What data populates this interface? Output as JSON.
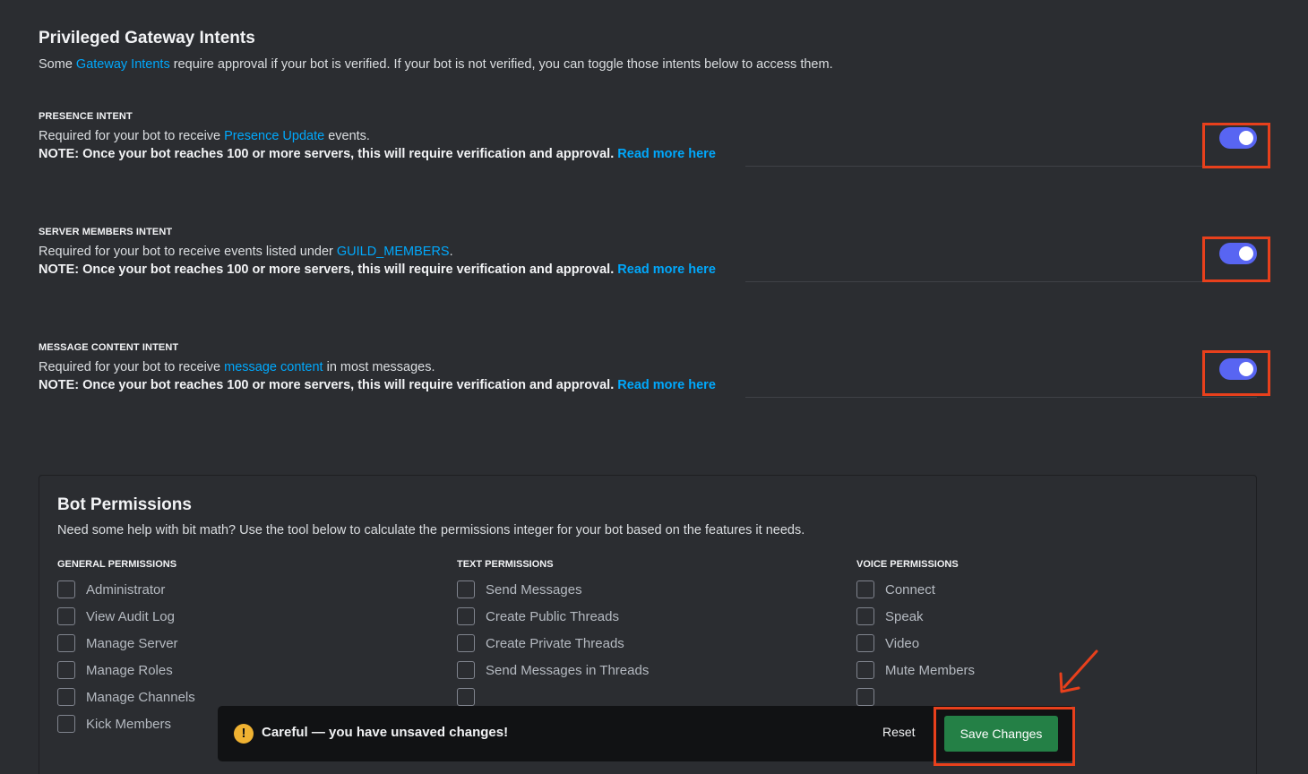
{
  "intents_section": {
    "title": "Privileged Gateway Intents",
    "desc_prefix": "Some ",
    "desc_link": "Gateway Intents",
    "desc_suffix": " require approval if your bot is verified. If your bot is not verified, you can toggle those intents below to access them."
  },
  "intents": [
    {
      "label": "PRESENCE INTENT",
      "desc_prefix": "Required for your bot to receive ",
      "desc_link": "Presence Update",
      "desc_suffix": " events.",
      "note": "NOTE: Once your bot reaches 100 or more servers, this will require verification and approval.",
      "note_link": "Read more here",
      "enabled": true
    },
    {
      "label": "SERVER MEMBERS INTENT",
      "desc_prefix": "Required for your bot to receive events listed under ",
      "desc_link": "GUILD_MEMBERS",
      "desc_suffix": ".",
      "note": "NOTE: Once your bot reaches 100 or more servers, this will require verification and approval.",
      "note_link": "Read more here",
      "enabled": true
    },
    {
      "label": "MESSAGE CONTENT INTENT",
      "desc_prefix": "Required for your bot to receive ",
      "desc_link": "message content",
      "desc_suffix": " in most messages.",
      "note": "NOTE: Once your bot reaches 100 or more servers, this will require verification and approval.",
      "note_link": "Read more here",
      "enabled": true
    }
  ],
  "permissions": {
    "title": "Bot Permissions",
    "desc": "Need some help with bit math? Use the tool below to calculate the permissions integer for your bot based on the features it needs.",
    "columns": [
      {
        "title": "GENERAL PERMISSIONS",
        "items": [
          "Administrator",
          "View Audit Log",
          "Manage Server",
          "Manage Roles",
          "Manage Channels",
          "Kick Members"
        ]
      },
      {
        "title": "TEXT PERMISSIONS",
        "items": [
          "Send Messages",
          "Create Public Threads",
          "Create Private Threads",
          "Send Messages in Threads"
        ]
      },
      {
        "title": "VOICE PERMISSIONS",
        "items": [
          "Connect",
          "Speak",
          "Video",
          "Mute Members"
        ]
      }
    ]
  },
  "save_bar": {
    "icon": "!",
    "message": "Careful — you have unsaved changes!",
    "reset_label": "Reset",
    "save_label": "Save Changes"
  },
  "colors": {
    "background": "#2b2d31",
    "toggle_on": "#5865f2",
    "link": "#00a8fc",
    "save_button": "#248046",
    "highlight": "#e8401c",
    "warning": "#f0b232"
  }
}
